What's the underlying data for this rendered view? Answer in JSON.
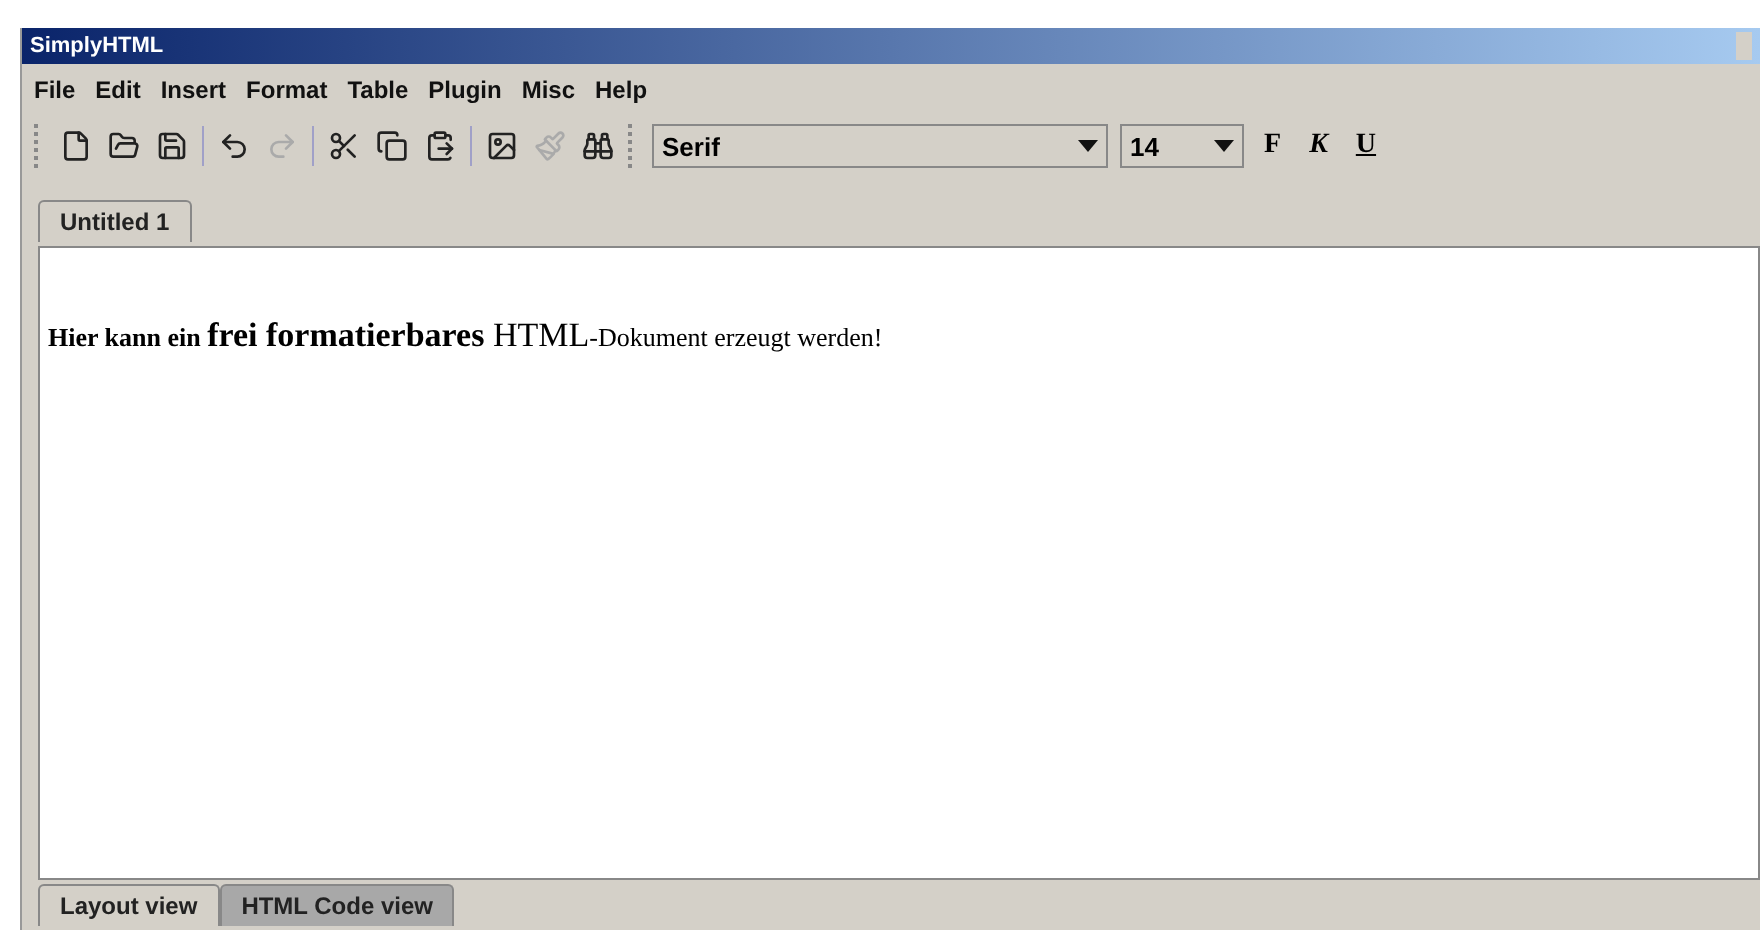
{
  "window": {
    "title": "SimplyHTML"
  },
  "menu": [
    "File",
    "Edit",
    "Insert",
    "Format",
    "Table",
    "Plugin",
    "Misc",
    "Help"
  ],
  "toolbar": [
    {
      "kind": "new",
      "disabled": false
    },
    {
      "kind": "open",
      "disabled": false
    },
    {
      "kind": "save",
      "disabled": false
    },
    {
      "kind": "sep"
    },
    {
      "kind": "undo",
      "disabled": false
    },
    {
      "kind": "redo",
      "disabled": true
    },
    {
      "kind": "sep"
    },
    {
      "kind": "cut",
      "disabled": false
    },
    {
      "kind": "copy",
      "disabled": false
    },
    {
      "kind": "paste",
      "disabled": false
    },
    {
      "kind": "sep"
    },
    {
      "kind": "image",
      "disabled": false
    },
    {
      "kind": "brush",
      "disabled": true
    },
    {
      "kind": "find",
      "disabled": false
    }
  ],
  "font": {
    "family": "Serif",
    "size": "14"
  },
  "format_buttons": [
    {
      "kind": "bold",
      "label": "F"
    },
    {
      "kind": "italic",
      "label": "K"
    },
    {
      "kind": "underline",
      "label": "U"
    }
  ],
  "doc_tabs": [
    {
      "label": "Untitled 1",
      "selected": true
    }
  ],
  "document": {
    "segments": [
      {
        "kind": "small-bold",
        "text": "Hier kann ein "
      },
      {
        "kind": "large-bold",
        "text": "frei formatierbares "
      },
      {
        "kind": "large",
        "text": "HTML"
      },
      {
        "kind": "small",
        "text": "-Dokument erzeugt werden!"
      }
    ]
  },
  "view_tabs": [
    {
      "label": "Layout view",
      "selected": true
    },
    {
      "label": "HTML Code view",
      "selected": false
    }
  ]
}
